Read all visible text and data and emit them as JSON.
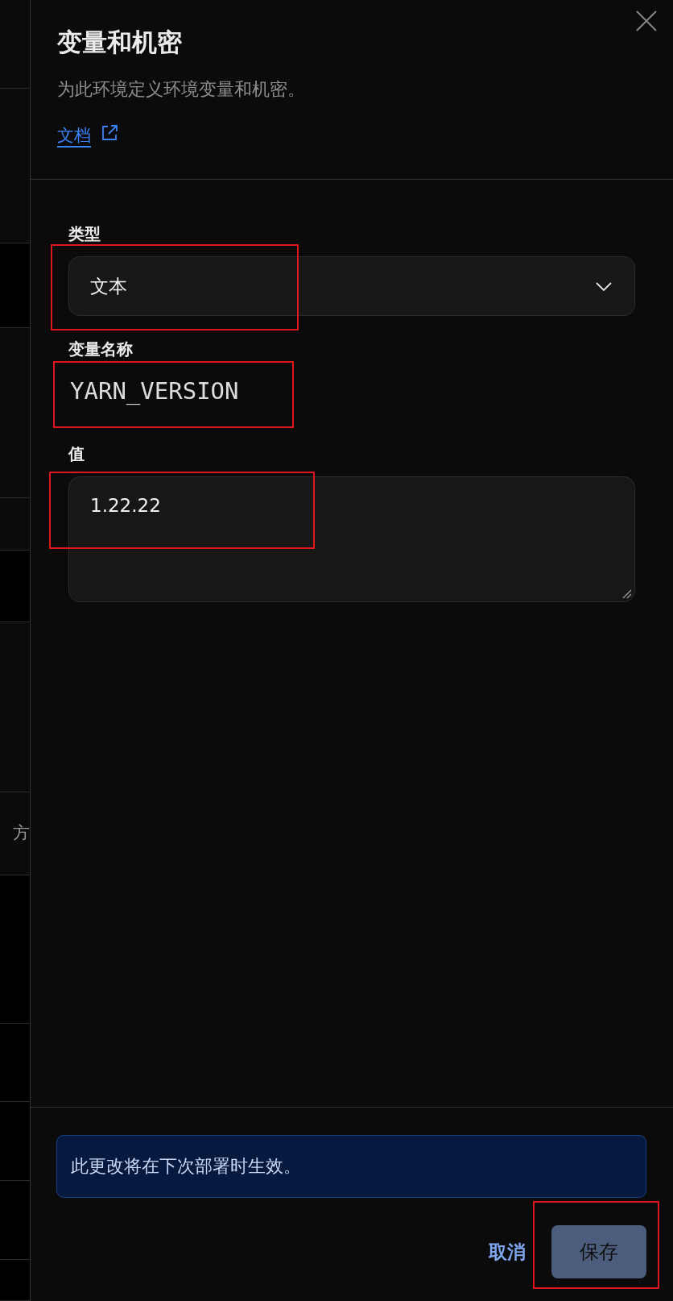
{
  "background_list": {
    "visible_text": "方"
  },
  "panel": {
    "title": "变量和机密",
    "description": "为此环境定义环境变量和机密。",
    "docs_link": "文档"
  },
  "form": {
    "fields": [
      {
        "kind": "select",
        "label": "类型",
        "value": "文本"
      },
      {
        "kind": "plain",
        "label": "变量名称",
        "value": "YARN_VERSION"
      },
      {
        "kind": "textarea",
        "label": "值",
        "value": "1.22.22"
      }
    ]
  },
  "notice": "此更改将在下次部署时生效。",
  "buttons": {
    "cancel": "取消",
    "save": "保存"
  }
}
